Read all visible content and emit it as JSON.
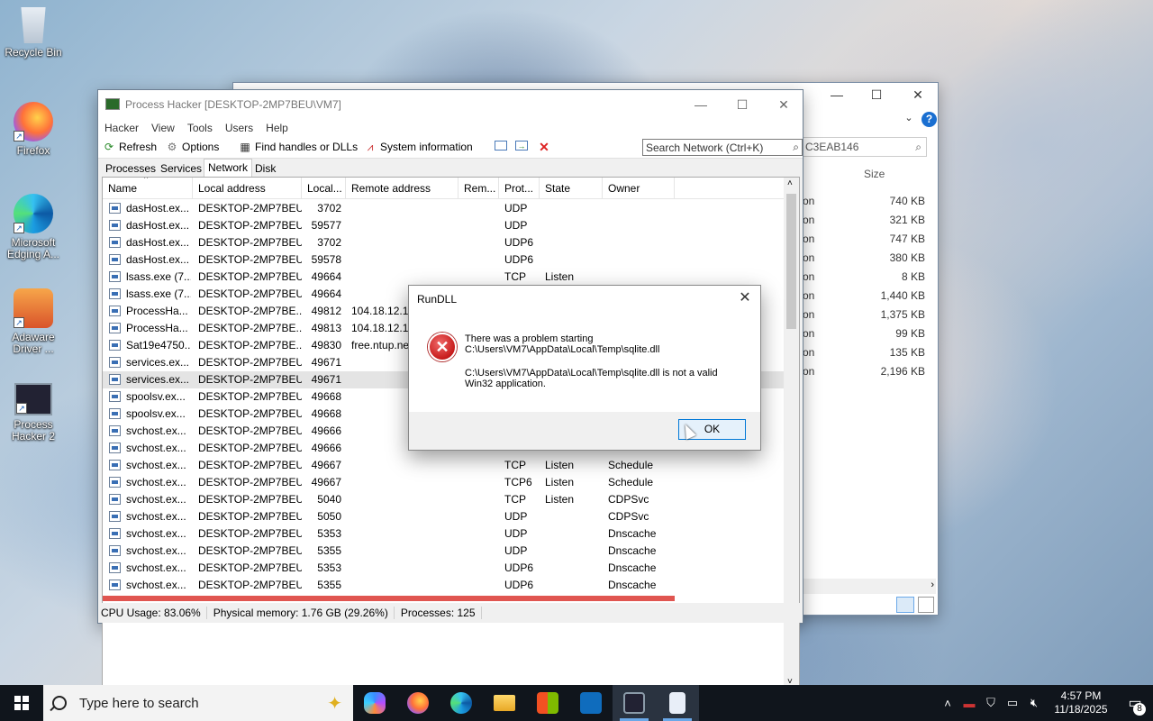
{
  "desktop": {
    "icons": [
      {
        "label": "Recycle Bin"
      },
      {
        "label": "Firefox"
      },
      {
        "label": "Microsoft Edging A..."
      },
      {
        "label": "Adaware Driver ..."
      },
      {
        "label": "Process Hacker 2"
      }
    ]
  },
  "explorer": {
    "search_text": "C3EAB146",
    "size_header": "Size",
    "sizes": [
      "740 KB",
      "321 KB",
      "747 KB",
      "380 KB",
      "8 KB",
      "1,440 KB",
      "1,375 KB",
      "99 KB",
      "135 KB",
      "2,196 KB"
    ],
    "stub": "on",
    "help_glyph": "?"
  },
  "process_hacker": {
    "title": "Process Hacker [DESKTOP-2MP7BEU\\VM7]",
    "menu": [
      "Hacker",
      "View",
      "Tools",
      "Users",
      "Help"
    ],
    "toolbar": {
      "refresh": "Refresh",
      "options": "Options",
      "find_handles": "Find handles or DLLs",
      "system_info": "System information",
      "search_placeholder": "Search Network (Ctrl+K)"
    },
    "tabs": [
      "Processes",
      "Services",
      "Network",
      "Disk"
    ],
    "active_tab": "Network",
    "columns": [
      "Name",
      "Local address",
      "Local...",
      "Remote address",
      "Rem...",
      "Prot...",
      "State",
      "Owner"
    ],
    "rows": [
      {
        "name": "dasHost.ex...",
        "local": "DESKTOP-2MP7BEU",
        "lport": "3702",
        "remote": "",
        "rport": "",
        "proto": "UDP",
        "state": "",
        "owner": ""
      },
      {
        "name": "dasHost.ex...",
        "local": "DESKTOP-2MP7BEU",
        "lport": "59577",
        "remote": "",
        "rport": "",
        "proto": "UDP",
        "state": "",
        "owner": ""
      },
      {
        "name": "dasHost.ex...",
        "local": "DESKTOP-2MP7BEU",
        "lport": "3702",
        "remote": "",
        "rport": "",
        "proto": "UDP6",
        "state": "",
        "owner": ""
      },
      {
        "name": "dasHost.ex...",
        "local": "DESKTOP-2MP7BEU",
        "lport": "59578",
        "remote": "",
        "rport": "",
        "proto": "UDP6",
        "state": "",
        "owner": ""
      },
      {
        "name": "lsass.exe (7...",
        "local": "DESKTOP-2MP7BEU",
        "lport": "49664",
        "remote": "",
        "rport": "",
        "proto": "TCP",
        "state": "Listen",
        "owner": ""
      },
      {
        "name": "lsass.exe (7...",
        "local": "DESKTOP-2MP7BEU",
        "lport": "49664",
        "remote": "",
        "rport": "",
        "proto": "",
        "state": "",
        "owner": ""
      },
      {
        "name": "ProcessHa...",
        "local": "DESKTOP-2MP7BE...",
        "lport": "49812",
        "remote": "104.18.12.149",
        "rport": "",
        "proto": "",
        "state": "",
        "owner": ""
      },
      {
        "name": "ProcessHa...",
        "local": "DESKTOP-2MP7BE...",
        "lport": "49813",
        "remote": "104.18.12.149",
        "rport": "",
        "proto": "",
        "state": "",
        "owner": ""
      },
      {
        "name": "Sat19e4750...",
        "local": "DESKTOP-2MP7BE...",
        "lport": "49830",
        "remote": "free.ntup.ne...",
        "rport": "",
        "proto": "",
        "state": "",
        "owner": ""
      },
      {
        "name": "services.ex...",
        "local": "DESKTOP-2MP7BEU",
        "lport": "49671",
        "remote": "",
        "rport": "",
        "proto": "",
        "state": "",
        "owner": ""
      },
      {
        "name": "services.ex...",
        "local": "DESKTOP-2MP7BEU",
        "lport": "49671",
        "remote": "",
        "rport": "",
        "proto": "",
        "state": "",
        "owner": ""
      },
      {
        "name": "spoolsv.ex...",
        "local": "DESKTOP-2MP7BEU",
        "lport": "49668",
        "remote": "",
        "rport": "",
        "proto": "",
        "state": "",
        "owner": ""
      },
      {
        "name": "spoolsv.ex...",
        "local": "DESKTOP-2MP7BEU",
        "lport": "49668",
        "remote": "",
        "rport": "",
        "proto": "",
        "state": "",
        "owner": ""
      },
      {
        "name": "svchost.ex...",
        "local": "DESKTOP-2MP7BEU",
        "lport": "49666",
        "remote": "",
        "rport": "",
        "proto": "",
        "state": "",
        "owner": ""
      },
      {
        "name": "svchost.ex...",
        "local": "DESKTOP-2MP7BEU",
        "lport": "49666",
        "remote": "",
        "rport": "",
        "proto": "",
        "state": "",
        "owner": ""
      },
      {
        "name": "svchost.ex...",
        "local": "DESKTOP-2MP7BEU",
        "lport": "49667",
        "remote": "",
        "rport": "",
        "proto": "TCP",
        "state": "Listen",
        "owner": "Schedule"
      },
      {
        "name": "svchost.ex...",
        "local": "DESKTOP-2MP7BEU",
        "lport": "49667",
        "remote": "",
        "rport": "",
        "proto": "TCP6",
        "state": "Listen",
        "owner": "Schedule"
      },
      {
        "name": "svchost.ex...",
        "local": "DESKTOP-2MP7BEU",
        "lport": "5040",
        "remote": "",
        "rport": "",
        "proto": "TCP",
        "state": "Listen",
        "owner": "CDPSvc"
      },
      {
        "name": "svchost.ex...",
        "local": "DESKTOP-2MP7BEU",
        "lport": "5050",
        "remote": "",
        "rport": "",
        "proto": "UDP",
        "state": "",
        "owner": "CDPSvc"
      },
      {
        "name": "svchost.ex...",
        "local": "DESKTOP-2MP7BEU",
        "lport": "5353",
        "remote": "",
        "rport": "",
        "proto": "UDP",
        "state": "",
        "owner": "Dnscache"
      },
      {
        "name": "svchost.ex...",
        "local": "DESKTOP-2MP7BEU",
        "lport": "5355",
        "remote": "",
        "rport": "",
        "proto": "UDP",
        "state": "",
        "owner": "Dnscache"
      },
      {
        "name": "svchost.ex...",
        "local": "DESKTOP-2MP7BEU",
        "lport": "5353",
        "remote": "",
        "rport": "",
        "proto": "UDP6",
        "state": "",
        "owner": "Dnscache"
      },
      {
        "name": "svchost.ex...",
        "local": "DESKTOP-2MP7BEU",
        "lport": "5355",
        "remote": "",
        "rport": "",
        "proto": "UDP6",
        "state": "",
        "owner": "Dnscache"
      }
    ],
    "status": {
      "cpu": "CPU Usage: 83.06%",
      "memory": "Physical memory: 1.76 GB (29.26%)",
      "processes": "Processes: 125"
    }
  },
  "dialog": {
    "title": "RunDLL",
    "line1": "There was a problem starting\nC:\\Users\\VM7\\AppData\\Local\\Temp\\sqlite.dll",
    "line2": "C:\\Users\\VM7\\AppData\\Local\\Temp\\sqlite.dll is not a valid\nWin32 application.",
    "ok": "OK"
  },
  "taskbar": {
    "search_placeholder": "Type here to search",
    "time": "4:57 PM",
    "date": "11/18/2025",
    "notification_count": "8"
  },
  "colors": {
    "highlight_row": "#e05550",
    "accent": "#0078d7"
  }
}
